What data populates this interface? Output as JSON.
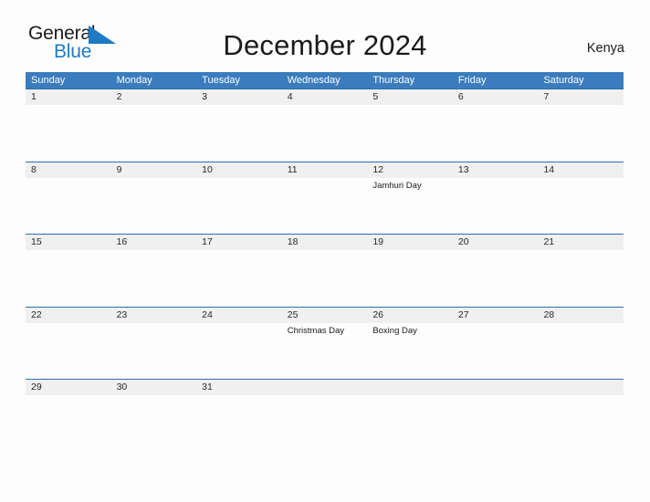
{
  "brand": {
    "name_part1": "General",
    "name_part2": "Blue",
    "flag_icon": "triangle-flag-icon",
    "color_dark": "#1b1b1b",
    "color_blue": "#1f7ac4"
  },
  "header": {
    "title": "December 2024",
    "region": "Kenya"
  },
  "calendar": {
    "accent_color": "#3a7cbd",
    "band_color": "#f0f0f0",
    "weekdays": [
      "Sunday",
      "Monday",
      "Tuesday",
      "Wednesday",
      "Thursday",
      "Friday",
      "Saturday"
    ],
    "weeks": [
      [
        {
          "day": "1",
          "events": []
        },
        {
          "day": "2",
          "events": []
        },
        {
          "day": "3",
          "events": []
        },
        {
          "day": "4",
          "events": []
        },
        {
          "day": "5",
          "events": []
        },
        {
          "day": "6",
          "events": []
        },
        {
          "day": "7",
          "events": []
        }
      ],
      [
        {
          "day": "8",
          "events": []
        },
        {
          "day": "9",
          "events": []
        },
        {
          "day": "10",
          "events": []
        },
        {
          "day": "11",
          "events": []
        },
        {
          "day": "12",
          "events": [
            "Jamhuri Day"
          ]
        },
        {
          "day": "13",
          "events": []
        },
        {
          "day": "14",
          "events": []
        }
      ],
      [
        {
          "day": "15",
          "events": []
        },
        {
          "day": "16",
          "events": []
        },
        {
          "day": "17",
          "events": []
        },
        {
          "day": "18",
          "events": []
        },
        {
          "day": "19",
          "events": []
        },
        {
          "day": "20",
          "events": []
        },
        {
          "day": "21",
          "events": []
        }
      ],
      [
        {
          "day": "22",
          "events": []
        },
        {
          "day": "23",
          "events": []
        },
        {
          "day": "24",
          "events": []
        },
        {
          "day": "25",
          "events": [
            "Christmas Day"
          ]
        },
        {
          "day": "26",
          "events": [
            "Boxing Day"
          ]
        },
        {
          "day": "27",
          "events": []
        },
        {
          "day": "28",
          "events": []
        }
      ],
      [
        {
          "day": "29",
          "events": []
        },
        {
          "day": "30",
          "events": []
        },
        {
          "day": "31",
          "events": []
        },
        {
          "day": "",
          "events": []
        },
        {
          "day": "",
          "events": []
        },
        {
          "day": "",
          "events": []
        },
        {
          "day": "",
          "events": []
        }
      ]
    ]
  }
}
